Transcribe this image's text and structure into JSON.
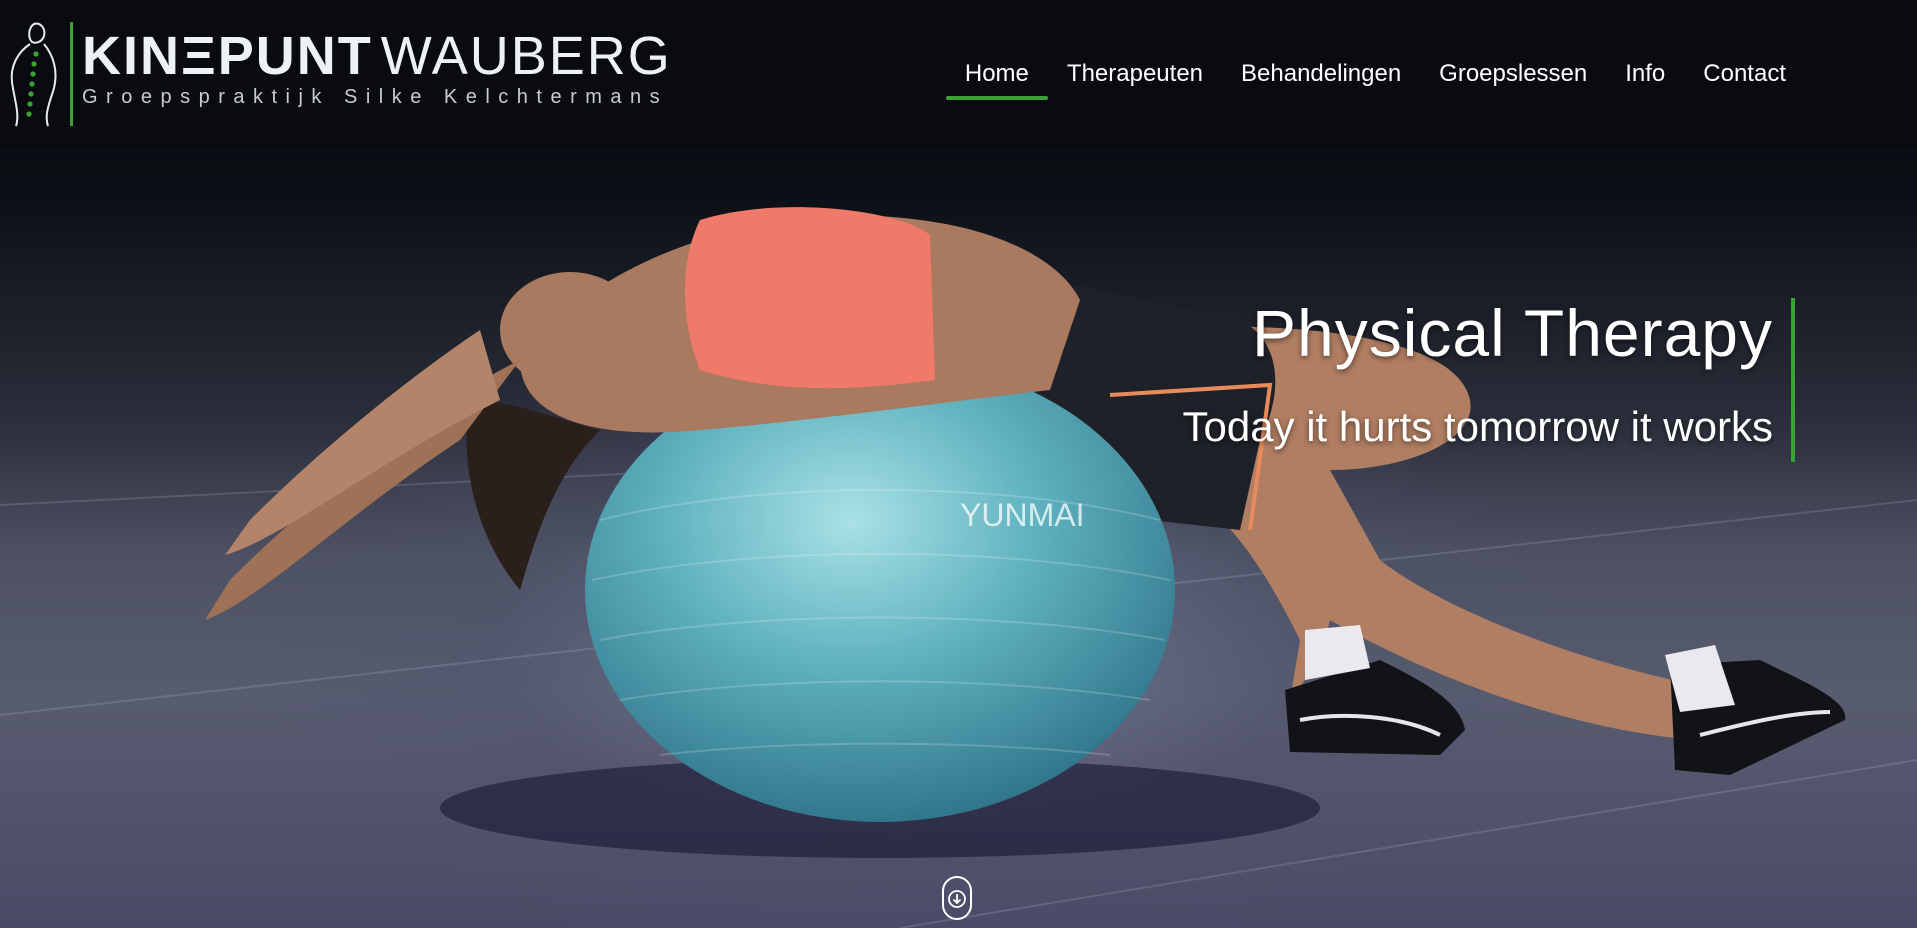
{
  "brand": {
    "name_bold": "KINΞPUNT",
    "name_light": "WAUBERG",
    "tagline": "Groepspraktijk Silke Kelchtermans",
    "logo_icon": "spine-figure-icon",
    "accent_color": "#3aa335"
  },
  "nav": {
    "items": [
      {
        "label": "Home",
        "active": true
      },
      {
        "label": "Therapeuten",
        "active": false
      },
      {
        "label": "Behandelingen",
        "active": false
      },
      {
        "label": "Groepslessen",
        "active": false
      },
      {
        "label": "Info",
        "active": false
      },
      {
        "label": "Contact",
        "active": false
      }
    ]
  },
  "hero": {
    "title": "Physical Therapy",
    "subtitle": "Today it hurts tomorrow it works",
    "ball_brand": "YUNMAI",
    "scroll_icon": "arrow-down-circle-icon"
  }
}
